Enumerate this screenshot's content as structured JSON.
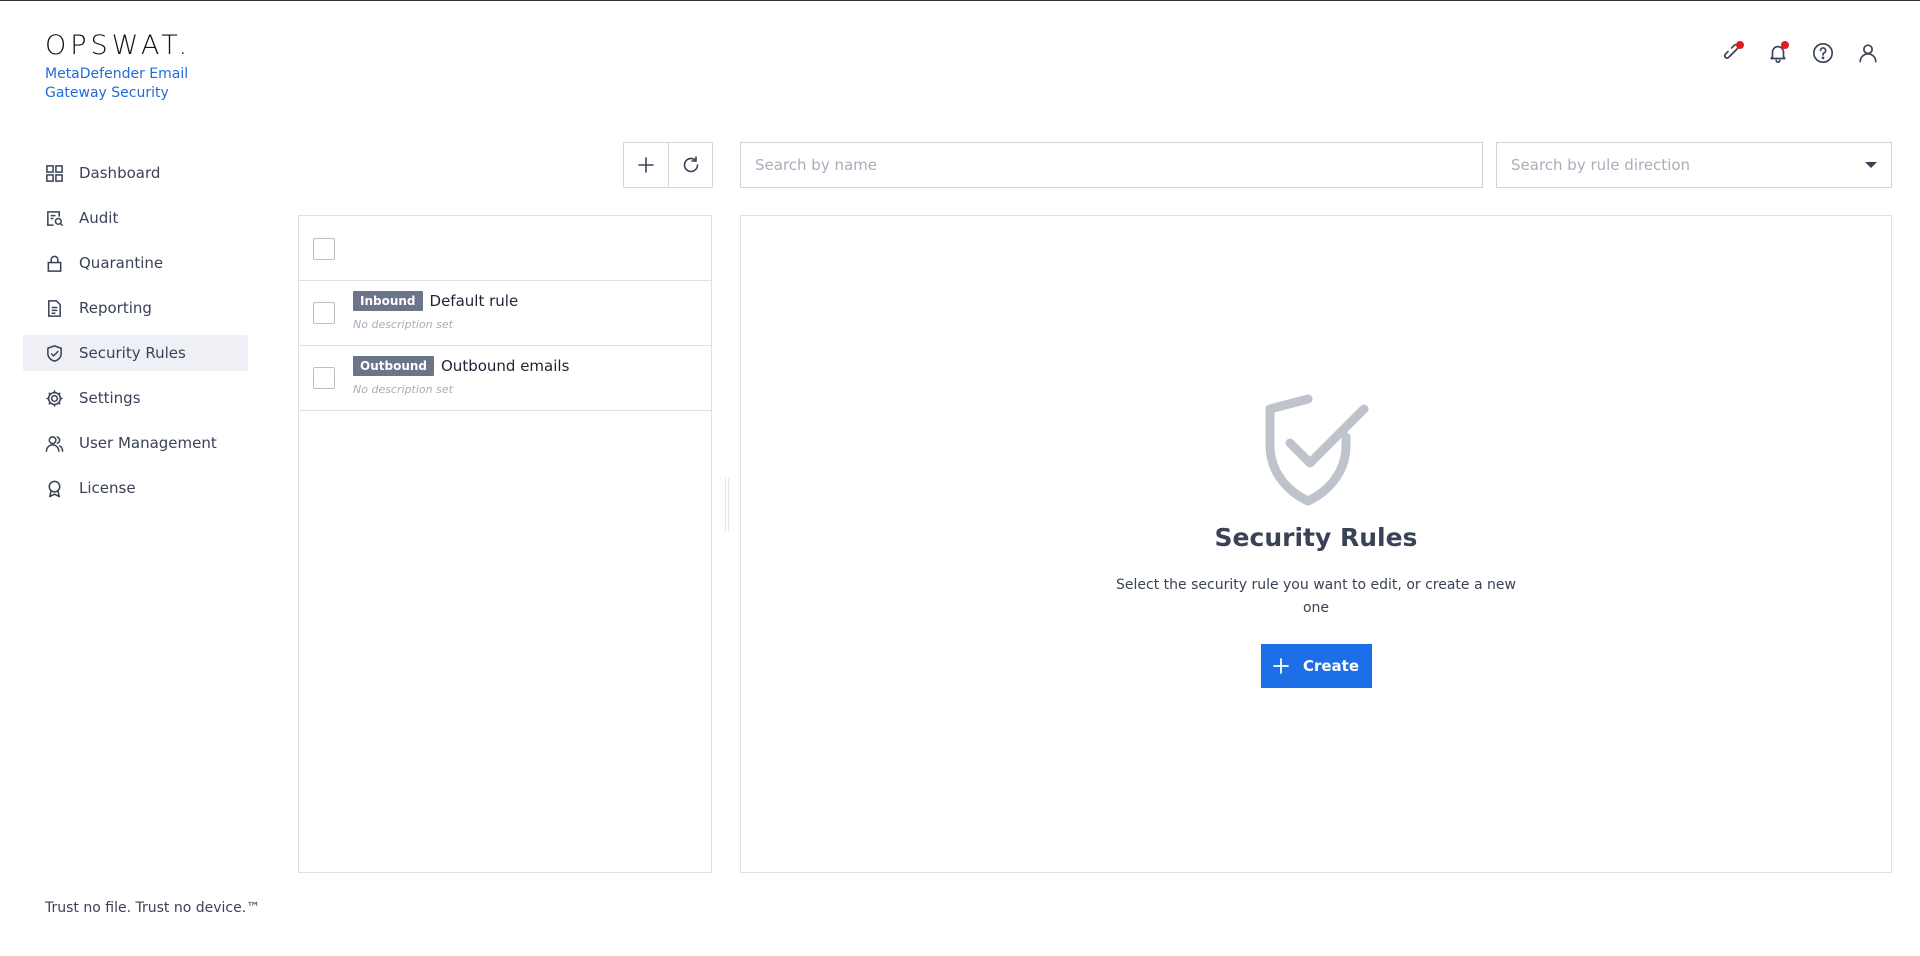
{
  "brand": {
    "logo": "OPSWAT.",
    "product": "MetaDefender Email Gateway Security"
  },
  "header": {
    "icons": [
      "integration-icon",
      "bell-icon",
      "help-icon",
      "user-icon"
    ]
  },
  "sidebar": {
    "items": [
      {
        "label": "Dashboard",
        "icon": "dashboard-icon",
        "active": false
      },
      {
        "label": "Audit",
        "icon": "audit-icon",
        "active": false
      },
      {
        "label": "Quarantine",
        "icon": "lock-icon",
        "active": false
      },
      {
        "label": "Reporting",
        "icon": "document-icon",
        "active": false
      },
      {
        "label": "Security Rules",
        "icon": "shield-check-icon",
        "active": true
      },
      {
        "label": "Settings",
        "icon": "gear-icon",
        "active": false
      },
      {
        "label": "User Management",
        "icon": "users-icon",
        "active": false
      },
      {
        "label": "License",
        "icon": "award-icon",
        "active": false
      }
    ]
  },
  "footer": {
    "tagline": "Trust no file. Trust no device.™"
  },
  "search": {
    "name_placeholder": "Search by name",
    "direction_placeholder": "Search by rule direction"
  },
  "rules": [
    {
      "direction": "Inbound",
      "name": "Default rule",
      "description": "No description set"
    },
    {
      "direction": "Outbound",
      "name": "Outbound emails",
      "description": "No description set"
    }
  ],
  "empty_state": {
    "title": "Security Rules",
    "text": "Select the security rule you want to edit, or create a new one",
    "create_label": "Create"
  },
  "colors": {
    "accent": "#1d6fe8",
    "badge": "#6b7488",
    "notification": "#e41b1b"
  }
}
